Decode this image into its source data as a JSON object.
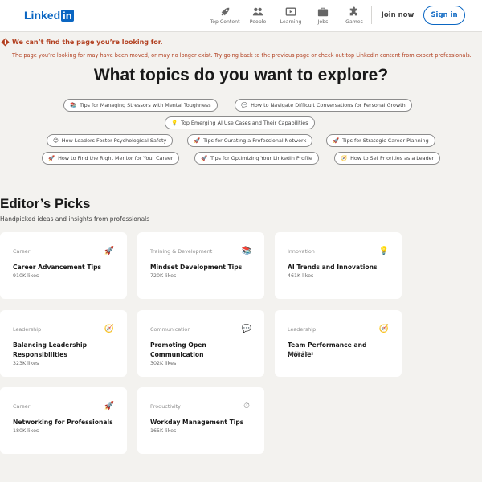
{
  "header": {
    "logo_text": "Linked",
    "logo_in": "in",
    "nav": [
      {
        "label": "Top Content",
        "icon": "rocket-icon"
      },
      {
        "label": "People",
        "icon": "people-icon"
      },
      {
        "label": "Learning",
        "icon": "play-icon"
      },
      {
        "label": "Jobs",
        "icon": "briefcase-icon"
      },
      {
        "label": "Games",
        "icon": "puzzle-icon"
      }
    ],
    "join_label": "Join now",
    "signin_label": "Sign in"
  },
  "error": {
    "title": "We can’t find the page you’re looking for.",
    "description": "The page you’re looking for may have been moved, or may no longer exist. Try going back to the previous page or check out top LinkedIn content from expert professionals."
  },
  "heading": "What topics do you want to explore?",
  "topics": [
    {
      "label": "Tips for Managing Stressors with Mental Toughness",
      "emoji": "📚"
    },
    {
      "label": "How to Navigate Difficult Conversations for Personal Growth",
      "emoji": "💬"
    },
    {
      "label": "Top Emerging AI Use Cases and Their Capabilities",
      "emoji": "💡"
    },
    {
      "label": "How Leaders Foster Psychological Safety",
      "emoji": "😊"
    },
    {
      "label": "Tips for Curating a Professional Network",
      "emoji": "🚀"
    },
    {
      "label": "Tips for Strategic Career Planning",
      "emoji": "🚀"
    },
    {
      "label": "How to Find the Right Mentor for Your Career",
      "emoji": "🚀"
    },
    {
      "label": "Tips for Optimizing Your LinkedIn Profile",
      "emoji": "🚀"
    },
    {
      "label": "How to Set Priorities as a Leader",
      "emoji": "🧭"
    }
  ],
  "editors_picks": {
    "title": "Editor’s Picks",
    "subtitle": "Handpicked ideas and insights from professionals",
    "cards": [
      {
        "category": "Career",
        "title": "Career Advancement Tips",
        "likes": "910K likes",
        "emoji": "🚀"
      },
      {
        "category": "Training & Development",
        "title": "Mindset Development Tips",
        "likes": "720K likes",
        "emoji": "📚"
      },
      {
        "category": "Innovation",
        "title": "AI Trends and Innovations",
        "likes": "461K likes",
        "emoji": "💡"
      },
      {
        "category": "Leadership",
        "title": "Balancing Leadership Responsibilities",
        "likes": "323K likes",
        "emoji": "🧭"
      },
      {
        "category": "Communication",
        "title": "Promoting Open Communication",
        "likes": "302K likes",
        "emoji": "💬"
      },
      {
        "category": "Leadership",
        "title": "Team Performance and Morale",
        "likes": "286K likes",
        "emoji": "🧭"
      },
      {
        "category": "Career",
        "title": "Networking for Professionals",
        "likes": "180K likes",
        "emoji": "🚀"
      },
      {
        "category": "Productivity",
        "title": "Workday Management Tips",
        "likes": "165K likes",
        "emoji": "⏱"
      }
    ]
  },
  "colors": {
    "brand": "#0a66c2",
    "error": "#b24020",
    "background": "#f3f2ef"
  }
}
